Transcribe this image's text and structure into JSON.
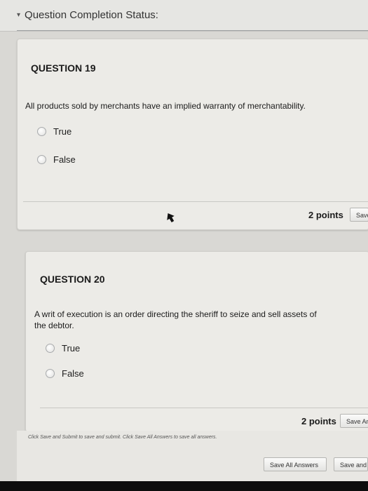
{
  "status": {
    "label": "Question Completion Status:"
  },
  "questions": [
    {
      "title": "QUESTION 19",
      "text": "All products sold by merchants have an implied warranty of merchantability.",
      "options": [
        "True",
        "False"
      ],
      "points": "2 points",
      "save_label": "Save"
    },
    {
      "title": "QUESTION 20",
      "text_line1": "A writ of execution is an order directing the sheriff to seize and sell assets of",
      "text_line2": "the debtor.",
      "options": [
        "True",
        "False"
      ],
      "points": "2 points",
      "save_label": "Save An"
    }
  ],
  "footer": {
    "note": "Click Save and Submit to save and submit. Click Save All Answers to save all answers.",
    "save_all_label": "Save All Answers",
    "save_submit_label": "Save and S"
  },
  "colors": {
    "accent_background": "#ecebe7",
    "page_background": "#d9d8d4"
  }
}
